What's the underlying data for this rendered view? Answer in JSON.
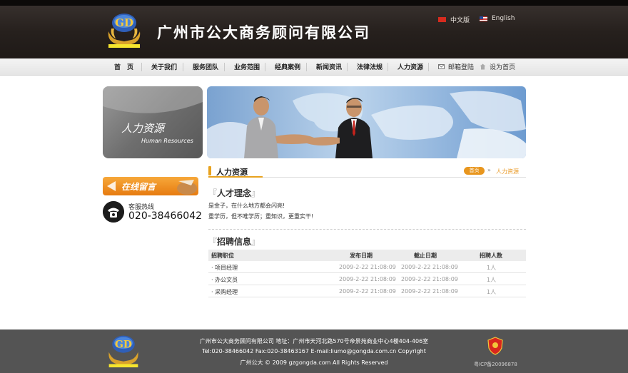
{
  "header": {
    "company_name": "广州市公大商务顾问有限公司",
    "logo_text": "GD",
    "lang_cn": "中文版",
    "lang_en": "English"
  },
  "nav": {
    "items": [
      "首　页",
      "关于我们",
      "服务团队",
      "业务范围",
      "经典案例",
      "新闻资讯",
      "法律法规",
      "人力资源"
    ],
    "mail_login": "邮箱登陆",
    "set_home": "设为首页"
  },
  "sidebar": {
    "hr_title_cn": "人力资源",
    "hr_title_en": "Human Resources",
    "message_button": "在线留言",
    "hotline_label": "客服热线",
    "hotline_number": "020-38466042"
  },
  "content": {
    "section_title": "人力资源",
    "breadcrumb_home": "首页",
    "breadcrumb_current": "人力资源",
    "philosophy_title": "人才理念",
    "philosophy_lines": [
      "是金子，在什么地方都会闪亮!",
      "重学历，但不唯学历；重知识，更重实干!"
    ],
    "recruit_title": "招聘信息",
    "table": {
      "headers": [
        "招聘职位",
        "发布日期",
        "截止日期",
        "招聘人数"
      ],
      "rows": [
        [
          "· 项目经理",
          "2009-2-22 21:08:09",
          "2009-2-22 21:08:09",
          "1人"
        ],
        [
          "· 办公文员",
          "2009-2-22 21:08:09",
          "2009-2-22 21:08:09",
          "1人"
        ],
        [
          "· 采购经理",
          "2009-2-22 21:08:09",
          "2009-2-22 21:08:09",
          "1人"
        ]
      ]
    }
  },
  "footer": {
    "line1": "广州市公大商务顾问有限公司 地址：广州市天河北路570号帝景苑商业中心4楼404-406室",
    "line2": "Tel:020-38466042 Fax:020-38463167 E-mail:liumo@gongda.com.cn Copyright",
    "line3": "广州公大 © 2009 gzgongda.com All Rights Reserved",
    "icp": "粤ICP备20096878"
  },
  "colors": {
    "accent": "#e8961e",
    "header_bg": "#26201d",
    "footer_bg": "#545454"
  }
}
